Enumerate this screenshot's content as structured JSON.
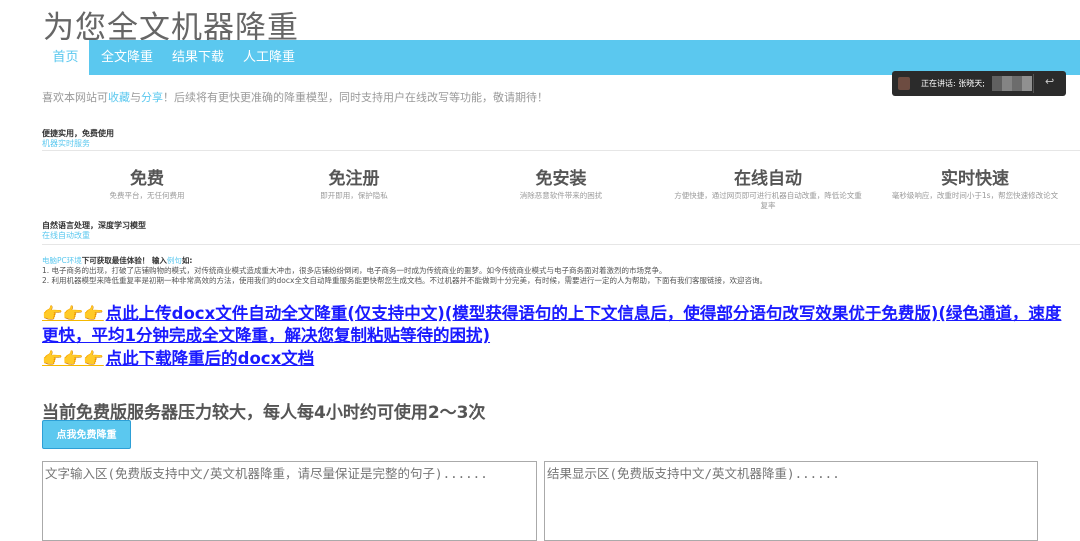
{
  "site_title": "为您全文机器降重",
  "nav": [
    "首页",
    "全文降重",
    "结果下载",
    "人工降重"
  ],
  "intro": {
    "prefix": "喜欢本网站可",
    "link1": "收藏",
    "mid": "与",
    "link2": "分享",
    "suffix": "！后续将有更快更准确的降重模型，同时支持用户在线改写等功能，敬请期待！"
  },
  "block1": {
    "title": "便捷实用，免费使用",
    "link": "机器实时服务"
  },
  "features": [
    {
      "title": "免费",
      "desc": "免费平台，无任何费用"
    },
    {
      "title": "免注册",
      "desc": "即开即用，保护隐私"
    },
    {
      "title": "免安装",
      "desc": "消除恶意软件带来的困扰"
    },
    {
      "title": "在线自动",
      "desc": "方便快捷，通过网页即可进行机器自动改重，降低论文重复率"
    },
    {
      "title": "实时快速",
      "desc": "毫秒级响应，改重时间小于1s，帮您快速修改论文"
    }
  ],
  "block2": {
    "title": "自然语言处理，深度学习模型",
    "link": "在线自动改重"
  },
  "notes": {
    "env_link": "电脑PC环境",
    "env_text": "下可获取最佳体验！ 输入",
    "example_link": "例句",
    "example_suffix": "如:",
    "line1": "1. 电子商务的出现，打破了店铺购物的模式，对传统商业模式造成重大冲击，很多店铺纷纷倒闭，电子商务一时成为传统商业的噩梦。如今传统商业模式与电子商务面对着激烈的市场竞争。",
    "line2": "2. 利用机器模型来降低重复率是初期一种非常高效的方法，使用我们的docx全文自动降重服务能更快帮您生成文档。不过机器并不能做到十分完美，有时候，需要进行一定的人为帮助，下面有我们客服链接，欢迎咨询。"
  },
  "hands": "👉👉👉",
  "upload_link": "点此上传docx文件自动全文降重(仅支持中文)(模型获得语句的上下文信息后，使得部分语句改写效果优于免费版)(绿色通道，速度更快，平均1分钟完成全文降重，解决您复制粘贴等待的困扰)",
  "download_link": "点此下载降重后的docx文档",
  "notice": "当前免费版服务器压力较大，每人每4小时约可使用2～3次",
  "free_button": "点我免费降重",
  "input_placeholder": "文字输入区(免费版支持中文/英文机器降重，请尽量保证是完整的句子)......",
  "output_placeholder": "结果显示区(免费版支持中文/英文机器降重)......",
  "speaking": "正在讲话: 张晓天;",
  "icons": {
    "hand": "pointing-hand-icon",
    "speaker_avatar": "avatar",
    "close": "hangup-icon"
  },
  "colors": {
    "nav": "#5bc8ef",
    "link": "#1a1aff",
    "accent": "#5bc8ef"
  }
}
